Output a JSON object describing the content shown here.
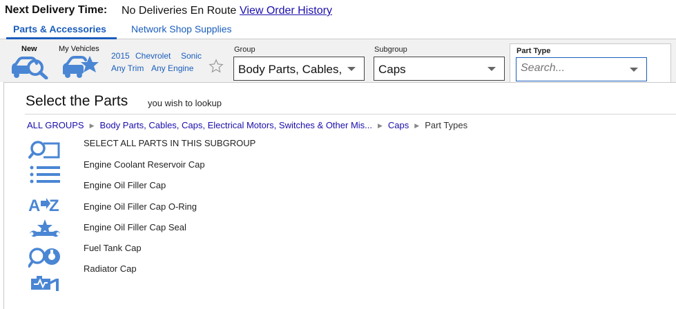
{
  "header": {
    "next_delivery_label": "Next Delivery Time:",
    "next_delivery_value": "No Deliveries En Route",
    "order_history_link": "View Order History"
  },
  "tabs": [
    {
      "label": "Parts & Accessories",
      "active": true
    },
    {
      "label": "Network Shop Supplies",
      "active": false
    }
  ],
  "vehicle_bar": {
    "new_label": "New",
    "my_vehicles_label": "My Vehicles",
    "year": "2015",
    "make": "Chevrolet",
    "model": "Sonic",
    "trim": "Any Trim",
    "engine": "Any Engine",
    "favorite_icon": "star-outline-icon"
  },
  "filters": {
    "group": {
      "label": "Group",
      "value": "Body Parts, Cables,"
    },
    "subgroup": {
      "label": "Subgroup",
      "value": "Caps"
    },
    "part_type": {
      "label": "Part Type",
      "placeholder": "Search..."
    }
  },
  "panel": {
    "title": "Select the Parts",
    "subtitle": "you wish to lookup",
    "breadcrumb": [
      {
        "label": "ALL GROUPS",
        "link": true
      },
      {
        "label": "Body Parts, Cables, Caps, Electrical Motors, Switches & Other Mis...",
        "link": true
      },
      {
        "label": "Caps",
        "link": true
      },
      {
        "label": "Part Types",
        "link": false
      }
    ],
    "parts": [
      "SELECT ALL PARTS IN THIS SUBGROUP",
      "Engine Coolant Reservoir Cap",
      "Engine Oil Filler Cap",
      "Engine Oil Filler Cap O-Ring",
      "Engine Oil Filler Cap Seal",
      "Fuel Tank Cap",
      "Radiator Cap"
    ],
    "side_icons": [
      "magnifier-part-icon",
      "list-icon",
      "a-to-z-icon",
      "star-wrench-icon",
      "tire-search-icon",
      "engine-diagnostic-icon"
    ]
  },
  "colors": {
    "accent": "#1a5dbd",
    "icon": "#4a86d4",
    "link": "#1a0dab"
  }
}
